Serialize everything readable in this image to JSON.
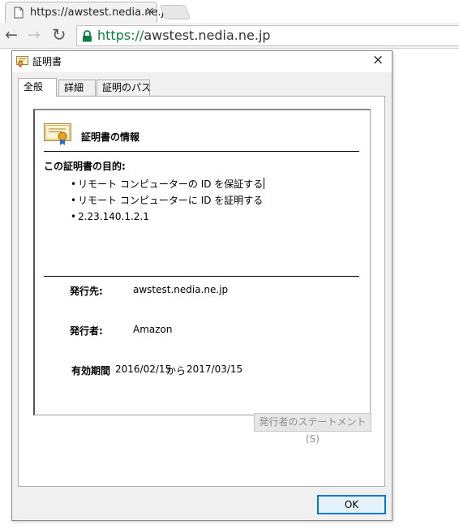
{
  "browser": {
    "tab_title": "https://awstest.nedia.ne.jp",
    "tab_close": "×",
    "url_scheme": "https://",
    "url_host": "awstest.nedia.ne.jp",
    "secure_color": "#0b8043",
    "icons": {
      "back": "arrow-left",
      "forward": "arrow-right",
      "reload": "reload",
      "lock": "lock",
      "page": "page"
    }
  },
  "dialog": {
    "title": "証明書",
    "close_glyph": "×",
    "tabs": [
      "全般",
      "詳細",
      "証明のパス"
    ],
    "active_tab": 0,
    "info_heading": "証明書の情報",
    "purpose_label": "この証明書の目的:",
    "purposes": [
      "リモート コンピューターの ID を保証する",
      "リモート コンピューターに ID を証明する",
      "2.23.140.1.2.1"
    ],
    "issued_to_label": "発行先:",
    "issued_to": "awstest.nedia.ne.jp",
    "issued_by_label": "発行者:",
    "issued_by": "Amazon",
    "validity_label": "有効期間",
    "valid_from": "2016/02/15",
    "validity_sep": "から",
    "valid_to": "2017/03/15",
    "statement_button": "発行者のステートメント(S)",
    "ok_button": "OK",
    "accent_color": "#0078d7"
  }
}
